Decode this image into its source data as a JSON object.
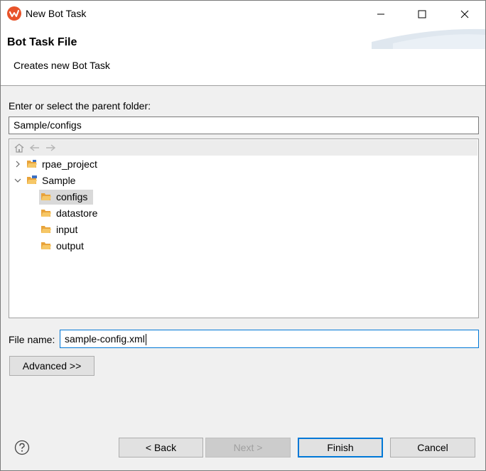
{
  "window": {
    "title": "New Bot Task",
    "minimize_icon": "minimize-icon",
    "maximize_icon": "maximize-icon",
    "close_icon": "close-icon"
  },
  "banner": {
    "title": "Bot Task File",
    "description": "Creates new Bot Task"
  },
  "parent_folder": {
    "label": "Enter or select the parent folder:",
    "value": "Sample/configs"
  },
  "tree": {
    "toolbar": [
      "home-icon",
      "back-arrow-icon",
      "forward-arrow-icon"
    ],
    "items": [
      {
        "label": "rpae_project",
        "expanded": false,
        "icon": "project-folder-icon"
      },
      {
        "label": "Sample",
        "expanded": true,
        "icon": "project-folder-icon"
      },
      {
        "label": "configs",
        "selected": true,
        "icon": "folder-icon"
      },
      {
        "label": "datastore",
        "icon": "folder-icon"
      },
      {
        "label": "input",
        "icon": "folder-icon"
      },
      {
        "label": "output",
        "icon": "folder-icon"
      }
    ]
  },
  "file_name": {
    "label": "File name:",
    "value": "sample-config.xml"
  },
  "buttons": {
    "advanced": "Advanced >>",
    "back": "< Back",
    "next": "Next >",
    "finish": "Finish",
    "cancel": "Cancel"
  },
  "colors": {
    "accent": "#0078d7",
    "selection": "#cce8ff",
    "folder": "#e8a33a"
  }
}
